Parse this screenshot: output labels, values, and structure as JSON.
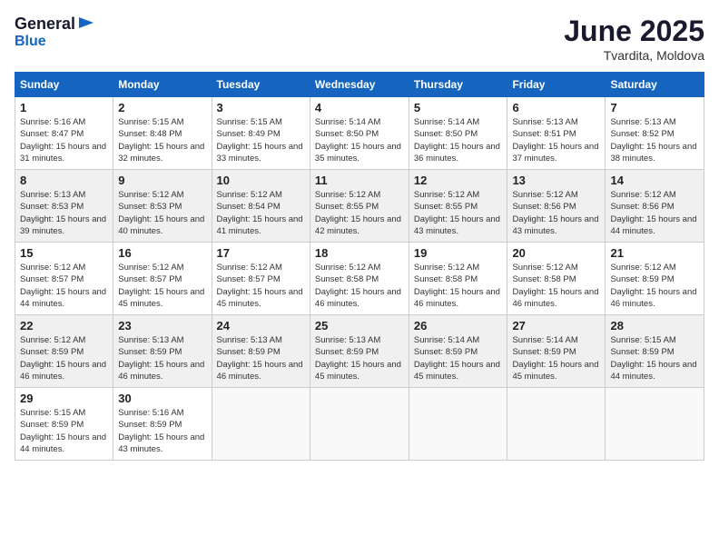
{
  "header": {
    "logo_general": "General",
    "logo_blue": "Blue",
    "month": "June 2025",
    "location": "Tvardita, Moldova"
  },
  "weekdays": [
    "Sunday",
    "Monday",
    "Tuesday",
    "Wednesday",
    "Thursday",
    "Friday",
    "Saturday"
  ],
  "weeks": [
    [
      {
        "day": "1",
        "sunrise": "5:16 AM",
        "sunset": "8:47 PM",
        "daylight": "15 hours and 31 minutes."
      },
      {
        "day": "2",
        "sunrise": "5:15 AM",
        "sunset": "8:48 PM",
        "daylight": "15 hours and 32 minutes."
      },
      {
        "day": "3",
        "sunrise": "5:15 AM",
        "sunset": "8:49 PM",
        "daylight": "15 hours and 33 minutes."
      },
      {
        "day": "4",
        "sunrise": "5:14 AM",
        "sunset": "8:50 PM",
        "daylight": "15 hours and 35 minutes."
      },
      {
        "day": "5",
        "sunrise": "5:14 AM",
        "sunset": "8:50 PM",
        "daylight": "15 hours and 36 minutes."
      },
      {
        "day": "6",
        "sunrise": "5:13 AM",
        "sunset": "8:51 PM",
        "daylight": "15 hours and 37 minutes."
      },
      {
        "day": "7",
        "sunrise": "5:13 AM",
        "sunset": "8:52 PM",
        "daylight": "15 hours and 38 minutes."
      }
    ],
    [
      {
        "day": "8",
        "sunrise": "5:13 AM",
        "sunset": "8:53 PM",
        "daylight": "15 hours and 39 minutes."
      },
      {
        "day": "9",
        "sunrise": "5:12 AM",
        "sunset": "8:53 PM",
        "daylight": "15 hours and 40 minutes."
      },
      {
        "day": "10",
        "sunrise": "5:12 AM",
        "sunset": "8:54 PM",
        "daylight": "15 hours and 41 minutes."
      },
      {
        "day": "11",
        "sunrise": "5:12 AM",
        "sunset": "8:55 PM",
        "daylight": "15 hours and 42 minutes."
      },
      {
        "day": "12",
        "sunrise": "5:12 AM",
        "sunset": "8:55 PM",
        "daylight": "15 hours and 43 minutes."
      },
      {
        "day": "13",
        "sunrise": "5:12 AM",
        "sunset": "8:56 PM",
        "daylight": "15 hours and 43 minutes."
      },
      {
        "day": "14",
        "sunrise": "5:12 AM",
        "sunset": "8:56 PM",
        "daylight": "15 hours and 44 minutes."
      }
    ],
    [
      {
        "day": "15",
        "sunrise": "5:12 AM",
        "sunset": "8:57 PM",
        "daylight": "15 hours and 44 minutes."
      },
      {
        "day": "16",
        "sunrise": "5:12 AM",
        "sunset": "8:57 PM",
        "daylight": "15 hours and 45 minutes."
      },
      {
        "day": "17",
        "sunrise": "5:12 AM",
        "sunset": "8:57 PM",
        "daylight": "15 hours and 45 minutes."
      },
      {
        "day": "18",
        "sunrise": "5:12 AM",
        "sunset": "8:58 PM",
        "daylight": "15 hours and 46 minutes."
      },
      {
        "day": "19",
        "sunrise": "5:12 AM",
        "sunset": "8:58 PM",
        "daylight": "15 hours and 46 minutes."
      },
      {
        "day": "20",
        "sunrise": "5:12 AM",
        "sunset": "8:58 PM",
        "daylight": "15 hours and 46 minutes."
      },
      {
        "day": "21",
        "sunrise": "5:12 AM",
        "sunset": "8:59 PM",
        "daylight": "15 hours and 46 minutes."
      }
    ],
    [
      {
        "day": "22",
        "sunrise": "5:12 AM",
        "sunset": "8:59 PM",
        "daylight": "15 hours and 46 minutes."
      },
      {
        "day": "23",
        "sunrise": "5:13 AM",
        "sunset": "8:59 PM",
        "daylight": "15 hours and 46 minutes."
      },
      {
        "day": "24",
        "sunrise": "5:13 AM",
        "sunset": "8:59 PM",
        "daylight": "15 hours and 46 minutes."
      },
      {
        "day": "25",
        "sunrise": "5:13 AM",
        "sunset": "8:59 PM",
        "daylight": "15 hours and 45 minutes."
      },
      {
        "day": "26",
        "sunrise": "5:14 AM",
        "sunset": "8:59 PM",
        "daylight": "15 hours and 45 minutes."
      },
      {
        "day": "27",
        "sunrise": "5:14 AM",
        "sunset": "8:59 PM",
        "daylight": "15 hours and 45 minutes."
      },
      {
        "day": "28",
        "sunrise": "5:15 AM",
        "sunset": "8:59 PM",
        "daylight": "15 hours and 44 minutes."
      }
    ],
    [
      {
        "day": "29",
        "sunrise": "5:15 AM",
        "sunset": "8:59 PM",
        "daylight": "15 hours and 44 minutes."
      },
      {
        "day": "30",
        "sunrise": "5:16 AM",
        "sunset": "8:59 PM",
        "daylight": "15 hours and 43 minutes."
      },
      null,
      null,
      null,
      null,
      null
    ]
  ]
}
